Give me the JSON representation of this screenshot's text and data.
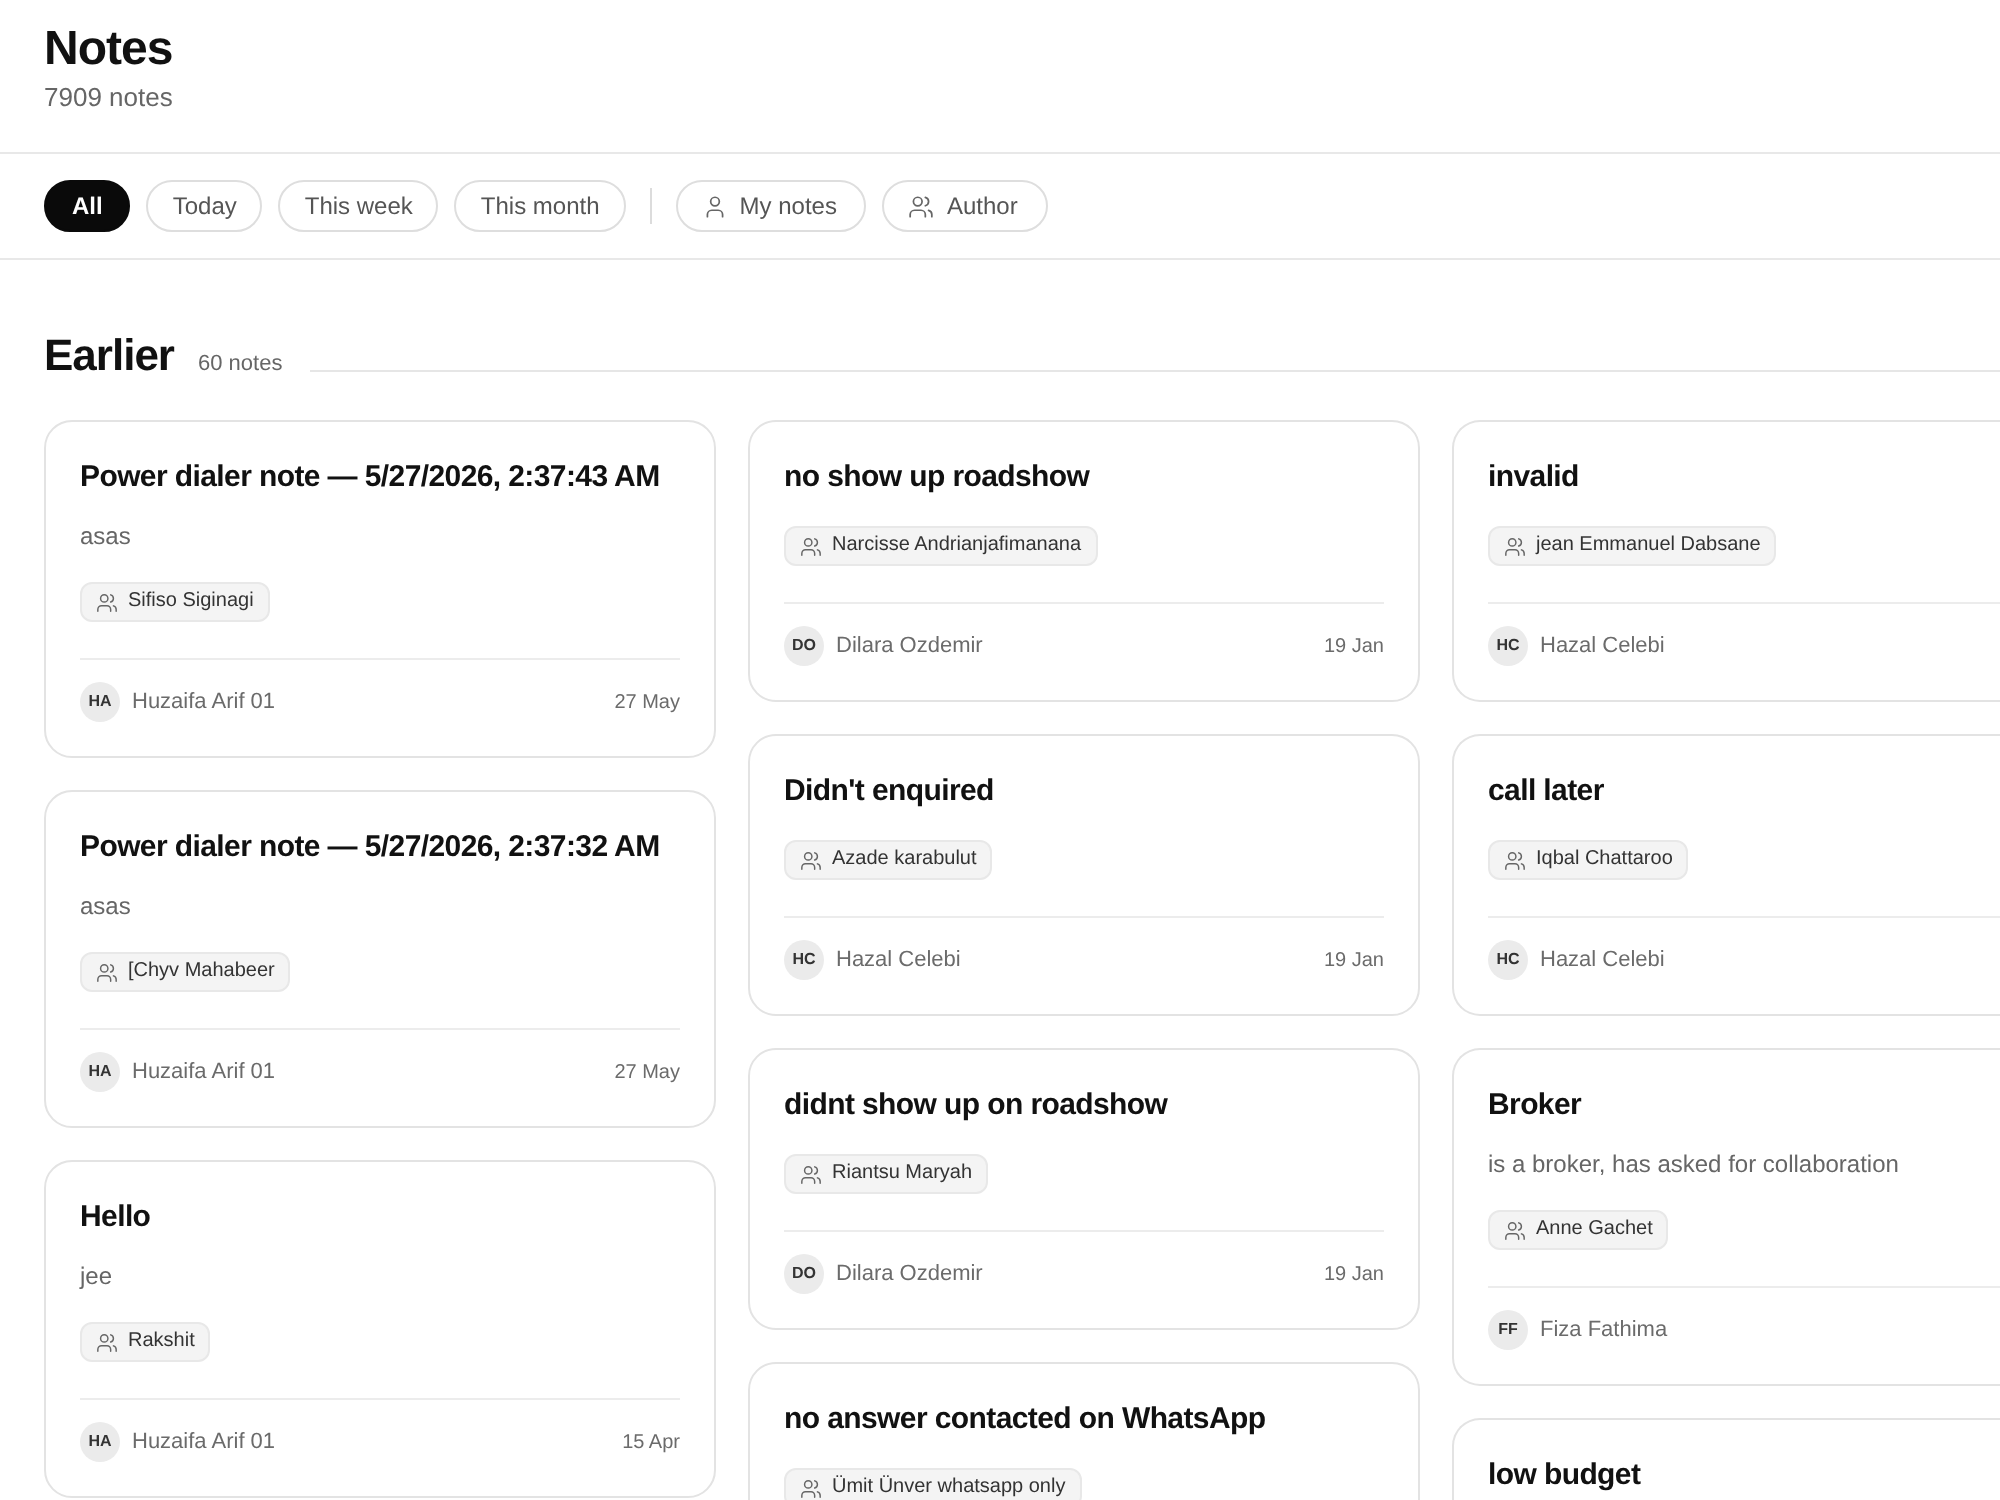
{
  "page": {
    "title": "Notes",
    "count": "7909 notes"
  },
  "filters": [
    {
      "label": "All",
      "kind": "period",
      "selected": true
    },
    {
      "label": "Today",
      "kind": "period",
      "selected": false
    },
    {
      "label": "This week",
      "kind": "period",
      "selected": false
    },
    {
      "label": "This month",
      "kind": "period",
      "selected": false
    },
    {
      "label": "My notes",
      "kind": "mine",
      "selected": false
    },
    {
      "label": "Author",
      "kind": "author",
      "selected": false
    }
  ],
  "section": {
    "title": "Earlier",
    "count": "60 notes"
  },
  "columns": [
    {
      "notes": [
        {
          "title": "Power dialer note — 5/27/2026, 2:37:43 AM",
          "body": "asas",
          "contact": "Sifiso Siginagi",
          "author": {
            "initials": "HA",
            "name": "Huzaifa Arif 01"
          },
          "date": "27 May"
        },
        {
          "title": "Power dialer note — 5/27/2026, 2:37:32 AM",
          "body": "asas",
          "contact": "[Chyv Mahabeer",
          "author": {
            "initials": "HA",
            "name": "Huzaifa Arif 01"
          },
          "date": "27 May"
        },
        {
          "title": "Hello",
          "body": "jee",
          "contact": "Rakshit",
          "author": {
            "initials": "HA",
            "name": "Huzaifa Arif 01"
          },
          "date": "15 Apr"
        }
      ]
    },
    {
      "notes": [
        {
          "title": "no show up roadshow",
          "contact": "Narcisse Andrianjafimanana",
          "author": {
            "initials": "DO",
            "name": "Dilara Ozdemir"
          },
          "date": "19 Jan"
        },
        {
          "title": "Didn't enquired",
          "contact": "Azade karabulut",
          "author": {
            "initials": "HC",
            "name": "Hazal Celebi"
          },
          "date": "19 Jan"
        },
        {
          "title": "didnt show up on roadshow",
          "contact": "Riantsu Maryah",
          "author": {
            "initials": "DO",
            "name": "Dilara Ozdemir"
          },
          "date": "19 Jan"
        },
        {
          "title": "no answer contacted on WhatsApp",
          "contact": "Ümit Ünver whatsapp only"
        }
      ]
    },
    {
      "notes": [
        {
          "title": "invalid",
          "contact": "jean Emmanuel Dabsane",
          "author": {
            "initials": "HC",
            "name": "Hazal Celebi"
          }
        },
        {
          "title": "call later",
          "contact": "Iqbal Chattaroo",
          "author": {
            "initials": "HC",
            "name": "Hazal Celebi"
          }
        },
        {
          "title": "Broker",
          "body": "is a broker, has asked for collaboration",
          "contact": "Anne Gachet",
          "author": {
            "initials": "FF",
            "name": "Fiza Fathima"
          }
        },
        {
          "title": "low budget"
        }
      ]
    }
  ]
}
